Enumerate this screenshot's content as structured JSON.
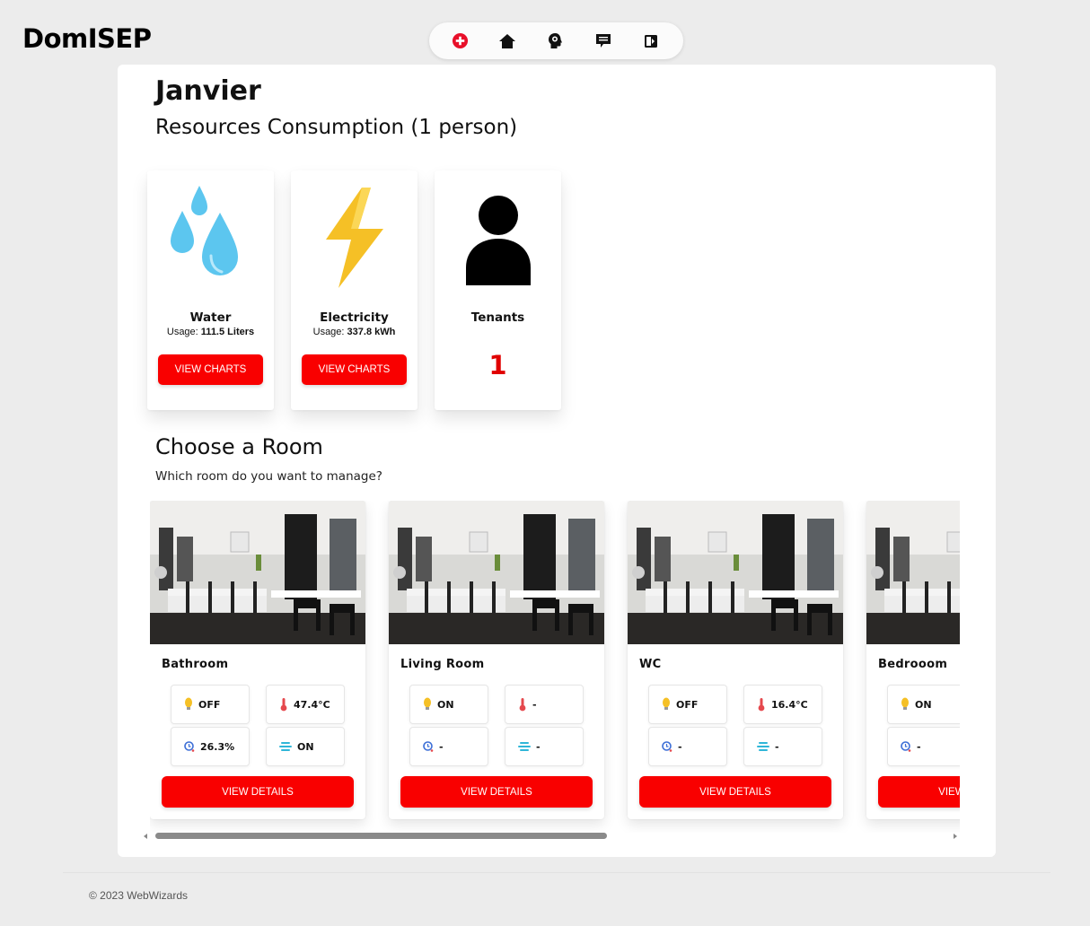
{
  "app": {
    "brand": "DomISEP"
  },
  "nav": {
    "items": [
      {
        "icon": "add-circle-icon"
      },
      {
        "icon": "home-icon"
      },
      {
        "icon": "idea-head-icon"
      },
      {
        "icon": "message-icon"
      },
      {
        "icon": "logout-icon"
      }
    ]
  },
  "page": {
    "month": "Janvier",
    "subtitle": "Resources Consumption (1 person)"
  },
  "resources": {
    "water": {
      "title": "Water",
      "usage_label": "Usage:",
      "usage_value": "111.5 Liters",
      "button": "VIEW CHARTS"
    },
    "electricity": {
      "title": "Electricity",
      "usage_label": "Usage:",
      "usage_value": "337.8 kWh",
      "button": "VIEW CHARTS"
    },
    "tenants": {
      "title": "Tenants",
      "count": "1"
    }
  },
  "rooms_section": {
    "title": "Choose a Room",
    "subtitle": "Which room do you want to manage?"
  },
  "rooms": [
    {
      "name": "Bathroom",
      "light": "OFF",
      "temperature": "47.4°C",
      "humidity": "26.3%",
      "air": "ON",
      "button": "VIEW DETAILS"
    },
    {
      "name": "Living Room",
      "light": "ON",
      "temperature": "-",
      "humidity": "-",
      "air": "-",
      "button": "VIEW DETAILS"
    },
    {
      "name": "WC",
      "light": "OFF",
      "temperature": "16.4°C",
      "humidity": "-",
      "air": "-",
      "button": "VIEW DETAILS"
    },
    {
      "name": "Bedrooom",
      "light": "ON",
      "temperature": "-",
      "humidity": "-",
      "air": "-",
      "button": "VIEW DETAILS"
    }
  ],
  "colors": {
    "accent": "#f90000",
    "water": "#5cc6ef",
    "electricity": "#f5c026"
  },
  "footer": {
    "text": "© 2023 WebWizards"
  }
}
